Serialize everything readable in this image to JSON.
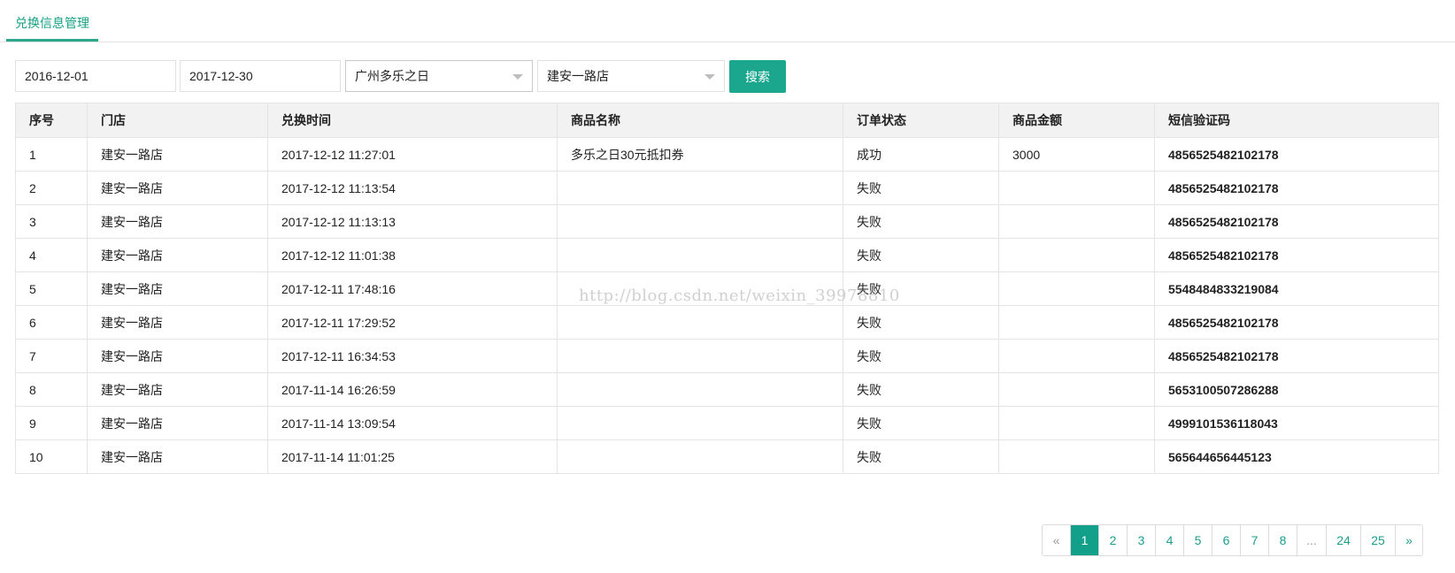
{
  "tabs": [
    {
      "label": "兑换信息管理"
    }
  ],
  "filters": {
    "start_date": "2016-12-01",
    "end_date": "2017-12-30",
    "brand": "广州多乐之日",
    "store": "建安一路店",
    "search_label": "搜索"
  },
  "table": {
    "headers": [
      "序号",
      "门店",
      "兑换时间",
      "商品名称",
      "订单状态",
      "商品金额",
      "短信验证码"
    ],
    "rows": [
      [
        "1",
        "建安一路店",
        "2017-12-12 11:27:01",
        "多乐之日30元抵扣券",
        "成功",
        "3000",
        "4856525482102178"
      ],
      [
        "2",
        "建安一路店",
        "2017-12-12 11:13:54",
        "",
        "失败",
        "",
        "4856525482102178"
      ],
      [
        "3",
        "建安一路店",
        "2017-12-12 11:13:13",
        "",
        "失败",
        "",
        "4856525482102178"
      ],
      [
        "4",
        "建安一路店",
        "2017-12-12 11:01:38",
        "",
        "失败",
        "",
        "4856525482102178"
      ],
      [
        "5",
        "建安一路店",
        "2017-12-11 17:48:16",
        "",
        "失败",
        "",
        "5548484833219084"
      ],
      [
        "6",
        "建安一路店",
        "2017-12-11 17:29:52",
        "",
        "失败",
        "",
        "4856525482102178"
      ],
      [
        "7",
        "建安一路店",
        "2017-12-11 16:34:53",
        "",
        "失败",
        "",
        "4856525482102178"
      ],
      [
        "8",
        "建安一路店",
        "2017-11-14 16:26:59",
        "",
        "失败",
        "",
        "5653100507286288"
      ],
      [
        "9",
        "建安一路店",
        "2017-11-14 13:09:54",
        "",
        "失败",
        "",
        "4999101536118043"
      ],
      [
        "10",
        "建安一路店",
        "2017-11-14 11:01:25",
        "",
        "失败",
        "",
        "565644656445123"
      ]
    ]
  },
  "watermark": "http://blog.csdn.net/weixin_39978810",
  "pagination": {
    "prev": "«",
    "pages": [
      "1",
      "2",
      "3",
      "4",
      "5",
      "6",
      "7",
      "8",
      "...",
      "24",
      "25"
    ],
    "next": "»",
    "current": "1"
  },
  "colors": {
    "accent": "#1aa78e",
    "tab_underline": "#2aa889",
    "header_bg": "#f2f2f2"
  }
}
